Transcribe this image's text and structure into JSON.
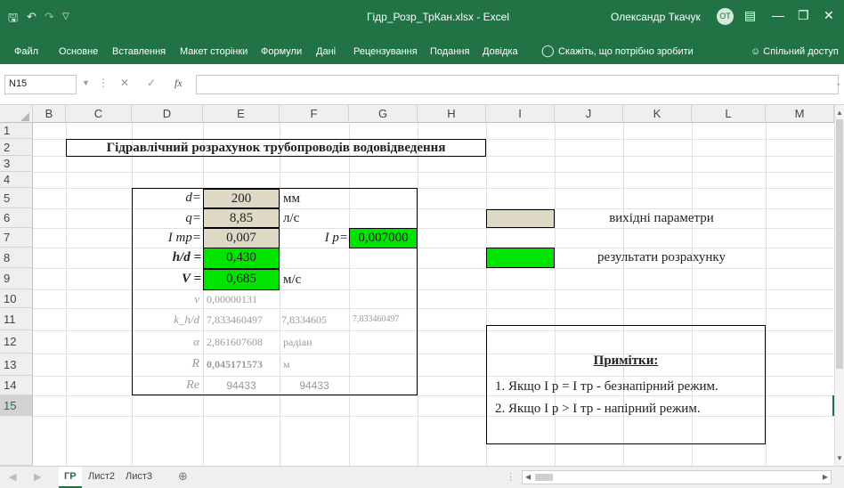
{
  "titlebar": {
    "title": "Гідр_Розр_ТрКан.xlsx  -  Excel",
    "user": "Олександр Ткачук",
    "avatar": "ОТ",
    "save_icon": "save-icon",
    "undo_icon": "undo-icon",
    "redo_icon": "redo-icon",
    "customize_icon": "customize-icon"
  },
  "ribbon": {
    "tabs": [
      "Файл",
      "Основне",
      "Вставлення",
      "Макет сторінки",
      "Формули",
      "Дані",
      "Рецензування",
      "Подання",
      "Довідка"
    ],
    "tell_me": "Скажіть, що потрібно зробити",
    "share": "Спільний доступ"
  },
  "formula_bar": {
    "name_box": "N15",
    "fx": "fx",
    "value": ""
  },
  "columns": [
    "B",
    "C",
    "D",
    "E",
    "F",
    "G",
    "H",
    "I",
    "J",
    "K",
    "L",
    "M"
  ],
  "rows": [
    "1",
    "2",
    "3",
    "4",
    "5",
    "6",
    "7",
    "8",
    "9",
    "10",
    "11",
    "12",
    "13",
    "14",
    "15"
  ],
  "sheet": {
    "title": "Гідравлічний розрахунок трубопроводів водовідведення",
    "d_label": "d=",
    "d_value": "200",
    "d_unit": "мм",
    "q_label": "q=",
    "q_value": "8,85",
    "q_unit": "л/с",
    "itr_label": "I тр=",
    "itr_value": "0,007",
    "ip_label": "I р=",
    "ip_value": "0,007000",
    "hd_label": "h/d =",
    "hd_value": "0,430",
    "v_label": "V =",
    "v_value": "0,685",
    "v_unit": "м/с",
    "nu_label": "ν",
    "nu_value": "0,00000131",
    "k_label": "k_h/d",
    "k_e": "7,833460497",
    "k_f": "7,8334605",
    "k_g": "7,833460497",
    "alpha_label": "α",
    "alpha_value": "2,861607608",
    "alpha_unit": "радіан",
    "r_label": "R",
    "r_value": "0,045171573",
    "r_unit": "м",
    "re_label": "Re",
    "re_e": "94433",
    "re_f": "94433"
  },
  "legend": {
    "input_text": "вихідні параметри",
    "result_text": "результати розрахунку",
    "input_color": "#ddd9c4",
    "result_color": "#00e400"
  },
  "notes": {
    "title": "Примітки:",
    "line1": "1. Якщо I р = I тр  - безнапірний режим.",
    "line2": "2. Якщо I р > I тр  - напірний режим."
  },
  "sheet_tabs": [
    "ГР",
    "Лист2",
    "Лист3"
  ],
  "accent": "#217346"
}
